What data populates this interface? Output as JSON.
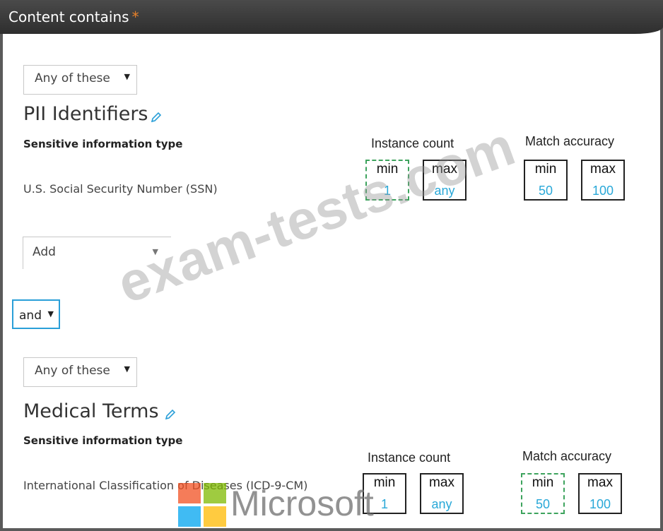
{
  "header": {
    "title": "Content contains",
    "required_mark": "*"
  },
  "groups": [
    {
      "match_option": "Any of these",
      "name": "PII Identifiers",
      "column_label": "Sensitive information type",
      "type_name": "U.S. Social Security Number (SSN)",
      "instance_count": {
        "heading": "Instance count",
        "min_label": "min",
        "min_value": "1",
        "max_label": "max",
        "max_value": "any"
      },
      "match_accuracy": {
        "heading": "Match accuracy",
        "min_label": "min",
        "min_value": "50",
        "max_label": "max",
        "max_value": "100"
      },
      "add_label": "Add"
    },
    {
      "match_option": "Any of these",
      "name": "Medical Terms",
      "column_label": "Sensitive information type",
      "type_name": "International Classification of Diseases (ICD-9-CM)",
      "instance_count": {
        "heading": "Instance count",
        "min_label": "min",
        "min_value": "1",
        "max_label": "max",
        "max_value": "any"
      },
      "match_accuracy": {
        "heading": "Match accuracy",
        "min_label": "min",
        "min_value": "50",
        "max_label": "max",
        "max_value": "100"
      }
    }
  ],
  "operator": "and",
  "watermark": "exam-tests.com",
  "logo_text": "Microsoft",
  "colors": {
    "accent": "#29a8d8",
    "required": "#e8822a",
    "dashed_border": "#3da35d"
  },
  "icons": {
    "edit": "pencil-icon",
    "dropdown": "caret-down-icon"
  }
}
